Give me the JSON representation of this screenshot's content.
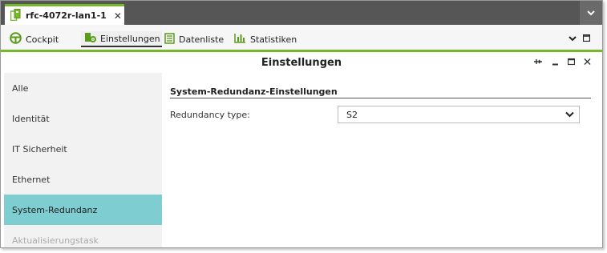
{
  "document_tab": {
    "label": "rfc-4072r-lan1-1",
    "close_glyph": "✕",
    "icon": "device-icon"
  },
  "toolbar": {
    "items": [
      {
        "label": "Cockpit",
        "icon": "steering-wheel-icon"
      },
      {
        "label": "Einstellungen",
        "icon": "settings-device-icon"
      },
      {
        "label": "Datenliste",
        "icon": "list-icon"
      },
      {
        "label": "Statistiken",
        "icon": "bar-chart-icon"
      }
    ],
    "active_index": 1
  },
  "panel": {
    "title": "Einstellungen",
    "controls": [
      "pin-icon",
      "minimize-icon",
      "maximize-icon",
      "close-icon"
    ]
  },
  "sidebar": {
    "items": [
      {
        "label": "Alle"
      },
      {
        "label": "Identität"
      },
      {
        "label": "IT Sicherheit"
      },
      {
        "label": "Ethernet"
      },
      {
        "label": "System-Redundanz"
      },
      {
        "label": "Aktualisierungstask"
      }
    ],
    "active_index": 4
  },
  "content": {
    "section_title": "System-Redundanz-Einstellungen",
    "field_label": "Redundancy type:",
    "field_value": "S2"
  },
  "colors": {
    "accent_green": "#76b82a",
    "active_nav": "#7ecdd0",
    "tabstrip": "#565656"
  }
}
